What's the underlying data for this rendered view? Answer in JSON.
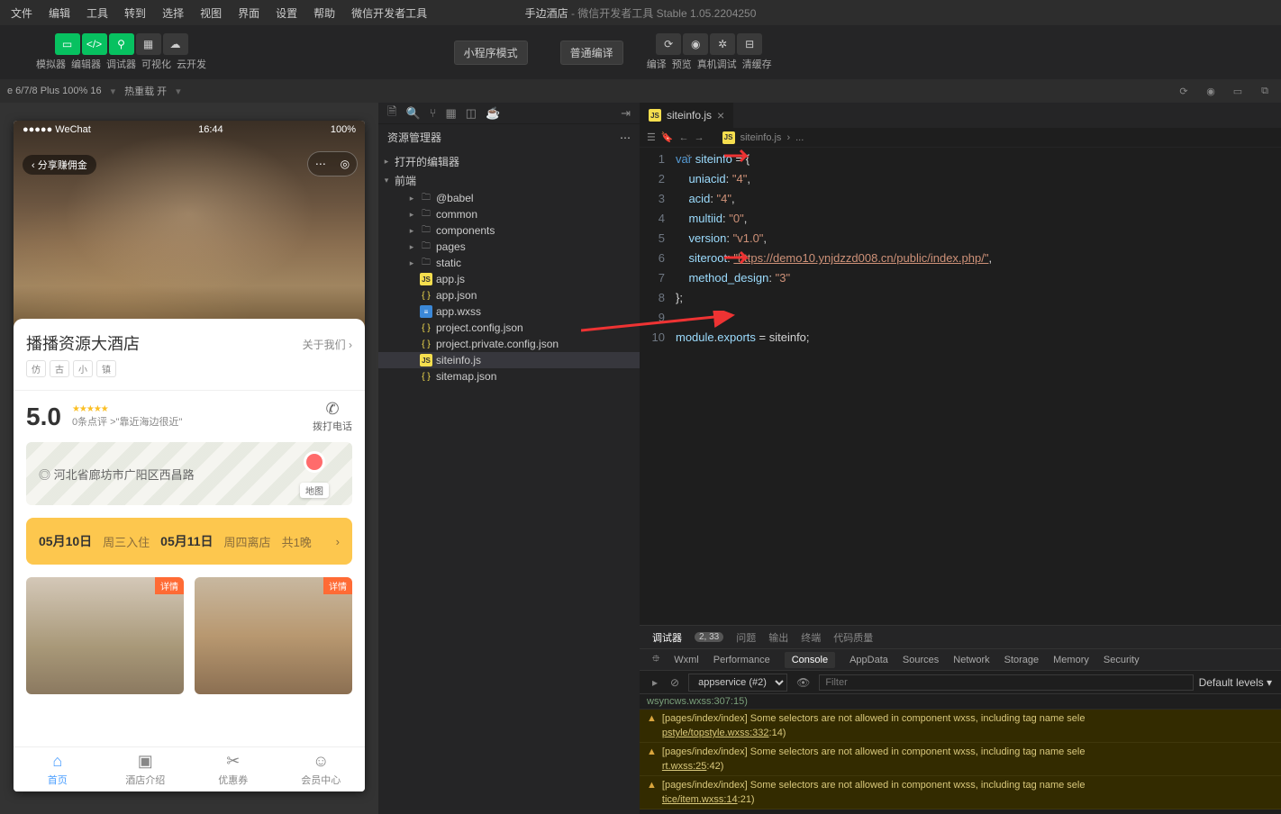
{
  "menu": {
    "items": [
      "文件",
      "编辑",
      "工具",
      "转到",
      "选择",
      "视图",
      "界面",
      "设置",
      "帮助",
      "微信开发者工具"
    ]
  },
  "title": {
    "project": "手边酒店",
    "app": "微信开发者工具 Stable 1.05.2204250"
  },
  "toolbar": {
    "group_labels": [
      "模拟器",
      "编辑器",
      "调试器",
      "可视化",
      "云开发"
    ],
    "mode_dropdown": "小程序模式",
    "compile_dropdown": "普通编译",
    "right_labels": [
      "编译",
      "预览",
      "真机调试",
      "清缓存"
    ]
  },
  "device_bar": {
    "device": "e 6/7/8 Plus 100% 16",
    "reload": "热重载 开"
  },
  "explorer": {
    "header": "资源管理器",
    "sections": {
      "opened": "打开的编辑器",
      "root": "前端"
    },
    "tree": [
      {
        "name": "@babel",
        "type": "folder",
        "depth": 2
      },
      {
        "name": "common",
        "type": "folder",
        "depth": 2
      },
      {
        "name": "components",
        "type": "folder",
        "depth": 2
      },
      {
        "name": "pages",
        "type": "folder",
        "depth": 2
      },
      {
        "name": "static",
        "type": "folder",
        "depth": 2
      },
      {
        "name": "app.js",
        "type": "js",
        "depth": 2
      },
      {
        "name": "app.json",
        "type": "json",
        "depth": 2
      },
      {
        "name": "app.wxss",
        "type": "wxss",
        "depth": 2
      },
      {
        "name": "project.config.json",
        "type": "json",
        "depth": 2
      },
      {
        "name": "project.private.config.json",
        "type": "json",
        "depth": 2
      },
      {
        "name": "siteinfo.js",
        "type": "js",
        "depth": 2,
        "selected": true
      },
      {
        "name": "sitemap.json",
        "type": "json",
        "depth": 2
      }
    ]
  },
  "editor": {
    "tab_file": "siteinfo.js",
    "breadcrumb_file": "siteinfo.js",
    "breadcrumb_more": "...",
    "code": {
      "l1_kw": "var",
      "l1_id": "siteinfo",
      "l1_rest": " = {",
      "l2_prop": "uniacid",
      "l2_val": "\"4\"",
      "l3_prop": "acid",
      "l3_val": "\"4\"",
      "l4_prop": "multiid",
      "l4_val": "\"0\"",
      "l5_prop": "version",
      "l5_val": "\"v1.0\"",
      "l6_prop": "siteroot",
      "l6_val": "\"https://demo10.ynjdzzd008.cn/public/index.php/\"",
      "l7_prop": "method_design",
      "l7_val": "\"3\"",
      "l8": "};",
      "l10_a": "module",
      "l10_b": "exports",
      "l10_c": " = siteinfo;"
    },
    "line_numbers": [
      "1",
      "2",
      "3",
      "4",
      "5",
      "6",
      "7",
      "8",
      "9",
      "10"
    ]
  },
  "simulator": {
    "status": {
      "left": "●●●●● WeChat",
      "time": "16:44",
      "right": "100%"
    },
    "share_label": "分享赚佣金",
    "hotel_name": "播播资源大酒店",
    "about": "关于我们",
    "tags": [
      "仿",
      "古",
      "小",
      "镇"
    ],
    "rating": "5.0",
    "review_count": "0条点评",
    "review_quote": ">\"靠近海边很近\"",
    "phone_label": "拨打电话",
    "address": "河北省廊坊市广阳区西昌路",
    "map_label": "地图",
    "date_in": "05月10日",
    "date_in_label": "周三入住",
    "date_out": "05月11日",
    "date_out_label": "周四离店",
    "nights": "共1晚",
    "room_badge": "详情",
    "tabs": [
      "首页",
      "酒店介绍",
      "优惠券",
      "会员中心"
    ]
  },
  "devtools": {
    "top_tabs": {
      "debugger": "调试器",
      "count": "2, 33",
      "problems": "问题",
      "output": "输出",
      "terminal": "终端",
      "quality": "代码质量"
    },
    "sub_tabs": [
      "Wxml",
      "Performance",
      "Console",
      "AppData",
      "Sources",
      "Network",
      "Storage",
      "Memory",
      "Security"
    ],
    "context": "appservice (#2)",
    "filter_placeholder": "Filter",
    "levels": "Default levels",
    "log_top": "wsyncws.wxss:307:15)",
    "warnings": [
      {
        "msg": "[pages/index/index] Some selectors are not allowed in component wxss, including tag name sele",
        "link": "pstyle/topstyle.wxss:332",
        "pos": ":14)"
      },
      {
        "msg": "[pages/index/index] Some selectors are not allowed in component wxss, including tag name sele",
        "link": "rt.wxss:25",
        "pos": ":42)"
      },
      {
        "msg": "[pages/index/index] Some selectors are not allowed in component wxss, including tag name sele",
        "link": "tice/item.wxss:14",
        "pos": ":21)"
      }
    ]
  }
}
